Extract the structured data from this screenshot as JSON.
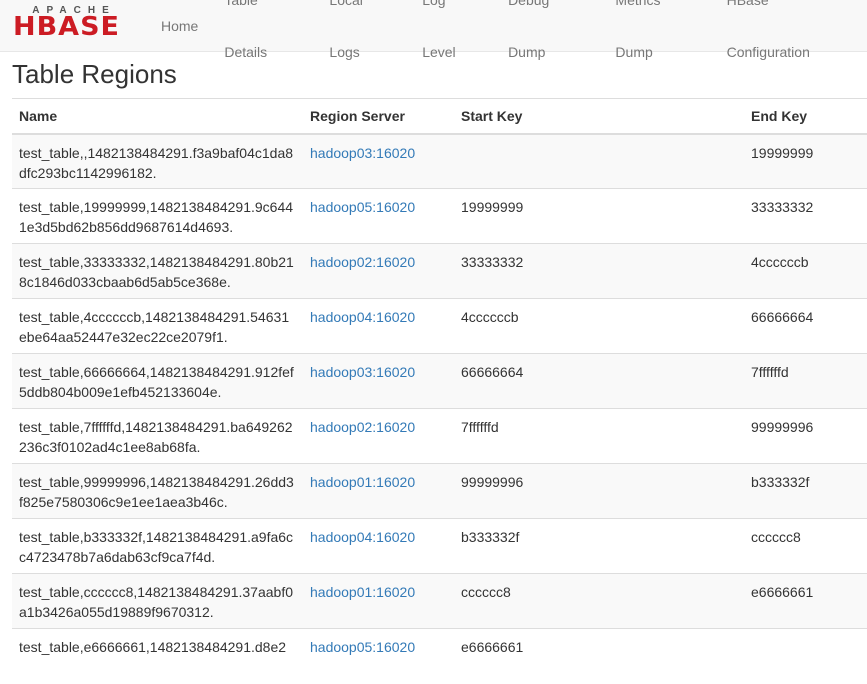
{
  "navbar": {
    "logo_top": "APACHE",
    "logo_main": "HBASE",
    "links": [
      {
        "label": "Home"
      },
      {
        "label": "Table Details"
      },
      {
        "label": "Local Logs"
      },
      {
        "label": "Log Level"
      },
      {
        "label": "Debug Dump"
      },
      {
        "label": "Metrics Dump"
      },
      {
        "label": "HBase Configuration"
      }
    ]
  },
  "page": {
    "title": "Table Regions"
  },
  "table": {
    "headers": {
      "name": "Name",
      "region_server": "Region Server",
      "start_key": "Start Key",
      "end_key": "End Key"
    },
    "rows": [
      {
        "name": "test_table,,1482138484291.f3a9baf04c1da8dfc293bc1142996182.",
        "server": "hadoop03:16020",
        "start_key": "",
        "end_key": "19999999"
      },
      {
        "name": "test_table,19999999,1482138484291.9c6441e3d5bd62b856dd9687614d4693.",
        "server": "hadoop05:16020",
        "start_key": "19999999",
        "end_key": "33333332"
      },
      {
        "name": "test_table,33333332,1482138484291.80b218c1846d033cbaab6d5ab5ce368e.",
        "server": "hadoop02:16020",
        "start_key": "33333332",
        "end_key": "4ccccccb"
      },
      {
        "name": "test_table,4ccccccb,1482138484291.54631ebe64aa52447e32ec22ce2079f1.",
        "server": "hadoop04:16020",
        "start_key": "4ccccccb",
        "end_key": "66666664"
      },
      {
        "name": "test_table,66666664,1482138484291.912fef5ddb804b009e1efb452133604e.",
        "server": "hadoop03:16020",
        "start_key": "66666664",
        "end_key": "7ffffffd"
      },
      {
        "name": "test_table,7ffffffd,1482138484291.ba649262236c3f0102ad4c1ee8ab68fa.",
        "server": "hadoop02:16020",
        "start_key": "7ffffffd",
        "end_key": "99999996"
      },
      {
        "name": "test_table,99999996,1482138484291.26dd3f825e7580306c9e1ee1aea3b46c.",
        "server": "hadoop01:16020",
        "start_key": "99999996",
        "end_key": "b333332f"
      },
      {
        "name": "test_table,b333332f,1482138484291.a9fa6cc4723478b7a6dab63cf9ca7f4d.",
        "server": "hadoop04:16020",
        "start_key": "b333332f",
        "end_key": "cccccc8"
      },
      {
        "name": "test_table,cccccc8,1482138484291.37aabf0a1b3426a055d19889f9670312.",
        "server": "hadoop01:16020",
        "start_key": "cccccc8",
        "end_key": "e6666661"
      },
      {
        "name": "test_table,e6666661,1482138484291.d8e2",
        "server": "hadoop05:16020",
        "start_key": "e6666661",
        "end_key": ""
      }
    ]
  }
}
